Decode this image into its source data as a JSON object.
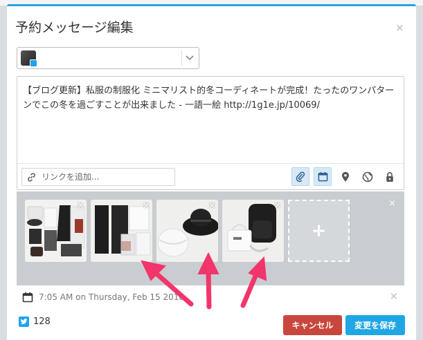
{
  "dialog": {
    "title": "予約メッセージ編集",
    "close_symbol": "×"
  },
  "account_select": {
    "selected": "",
    "avatar_icon": "profile-avatar-with-twitter-badge",
    "dropdown_icon": "chevron-down-icon"
  },
  "composer": {
    "message": "【ブログ更新】私服の制服化 ミニマリスト的冬コーディネートが完成！たったのワンパターンでこの冬を過ごすことが出来ました - 一語一絵 http://1g1e.jp/10069/",
    "link_placeholder": "リンクを追加...",
    "tools": [
      "attachment-icon",
      "calendar-icon",
      "location-pin-icon",
      "globe-icon",
      "lock-icon"
    ],
    "active_tools": [
      "attachment-icon",
      "calendar-icon"
    ]
  },
  "media": {
    "thumbnails": [
      {
        "subject": "folded clothes, shoes and hat"
      },
      {
        "subject": "trousers and shirts"
      },
      {
        "subject": "black and white knit hats"
      },
      {
        "subject": "black backpack and tote bag"
      }
    ],
    "add_symbol": "+",
    "remove_symbol": "×"
  },
  "schedule": {
    "text": "7:05 AM on Thursday, Feb 15 2018"
  },
  "footer": {
    "char_count": "128",
    "cancel_label": "キャンセル",
    "save_label": "変更を保存"
  },
  "colors": {
    "accent": "#2aa0dd",
    "cancel": "#c9463d",
    "save": "#1fa6e4",
    "annotation_arrow": "#f2356b",
    "twitter": "#1da1f2"
  }
}
